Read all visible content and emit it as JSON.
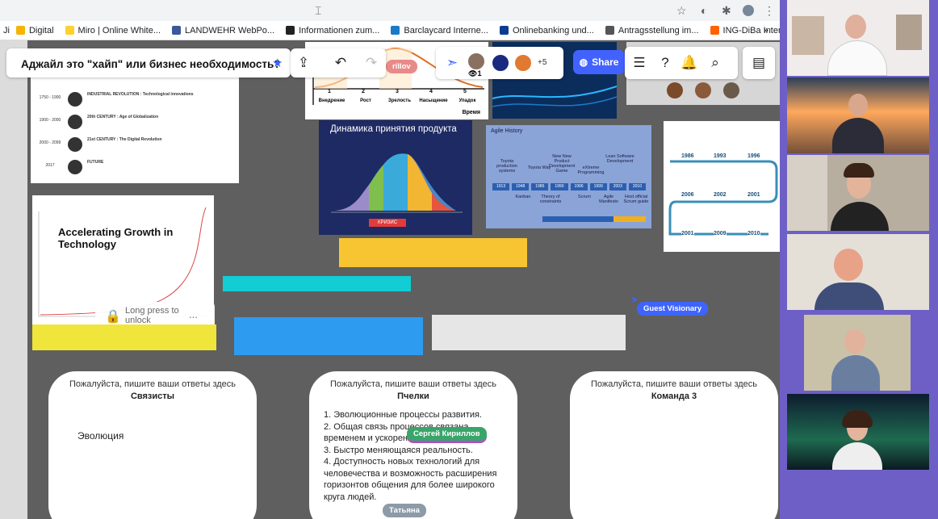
{
  "browser": {
    "bookmarks": [
      {
        "label": "Digital",
        "color": "#f5b400"
      },
      {
        "label": "Miro | Online White...",
        "color": "#ffd02f"
      },
      {
        "label": "LANDWEHR WebPo...",
        "color": "#3b5998"
      },
      {
        "label": "Informationen zum...",
        "color": "#222222"
      },
      {
        "label": "Barclaycard Interne...",
        "color": "#1a7ac6"
      },
      {
        "label": "Onlinebanking und...",
        "color": "#0a3d91"
      },
      {
        "label": "Antragsstellung im...",
        "color": "#555555"
      },
      {
        "label": "ING-DiBa Internetb...",
        "color": "#ff6200"
      }
    ],
    "bookmarks_prefix": "Ji",
    "overflow_label": "»"
  },
  "toolbar": {
    "board_title": "Аджайл это \"хайп\" или бизнес необходимость?",
    "share_label": "Share",
    "extra_collaborators": "+5",
    "viewer_count": "1"
  },
  "canvas": {
    "timeline_rows": [
      {
        "year": "1750 - 1900",
        "title": "INDUSTRIAL REVOLUTION : Technological innovations"
      },
      {
        "year": "1900 - 2000",
        "title": "20th CENTURY : Age of Globalization"
      },
      {
        "year": "2000 - 2099",
        "title": "21st CENTURY : The Digital Revolution"
      },
      {
        "year": "2017",
        "title": "FUTURE"
      }
    ],
    "accelerating_title": "Accelerating Growth in Technology",
    "lock_label": "Long press to unlock",
    "lock_menu": "...",
    "lifecycle_xlabel": "Время",
    "lifecycle_stages": [
      "Внедрение",
      "Рост",
      "Зрелость",
      "Насыщение",
      "Упадок"
    ],
    "lifecycle_numbers": [
      "1",
      "2",
      "3",
      "4",
      "5"
    ],
    "adoption_title": "Динамика принятия продукта",
    "adoption_crisis": "КРИЗИС",
    "agile_title": "Agile History",
    "agile_labels": [
      "Toyota production systems",
      "Toyota Way",
      "New New Product Development Game",
      "eXtreme Programming",
      "Lean Software Development",
      "Kanban",
      "Theory of constraints",
      "Scrum",
      "Agile Manifesto",
      "Host official Scrum guide"
    ],
    "agile_years": [
      "1913",
      "1948",
      "1986",
      "1990",
      "1996",
      "1999",
      "2003",
      "2010"
    ],
    "phone_years": [
      "1986",
      "1993",
      "1996",
      "2006",
      "2002",
      "2001",
      "2001",
      "2009",
      "2010"
    ],
    "guest_tag": "Guest Visionary",
    "cursor_tag": "Сергей Кириллов",
    "cursor_tag_partial": "rillov",
    "cursor_tag_tatiana": "Татьяна"
  },
  "answers": [
    {
      "prompt": "Пожалуйста, пишите ваши ответы здесь",
      "team": "Связисты",
      "text": "Эволюция"
    },
    {
      "prompt": "Пожалуйста, пишите ваши ответы здесь",
      "team": "Пчелки",
      "items": [
        "1. Эволюционные процессы развития.",
        "2. Общая связь процессов связана",
        "временем и ускорением.",
        "3. Быстро меняющаяся реальность.",
        "4. Доступность новых технологий для",
        "человечества и возможность расширения",
        "горизонтов общения для более широкого",
        "круга людей."
      ]
    },
    {
      "prompt": "Пожалуйста, пишите ваши ответы здесь",
      "team": "Команда 3"
    }
  ],
  "colors": {
    "accent": "#4262ff",
    "sticky_yellow": "#f7c531",
    "sticky_cyan": "#12cdd4",
    "sticky_blue": "#2d9bf0",
    "sticky_gray": "#e6e6e6",
    "video_border": "#6e5fc7"
  }
}
